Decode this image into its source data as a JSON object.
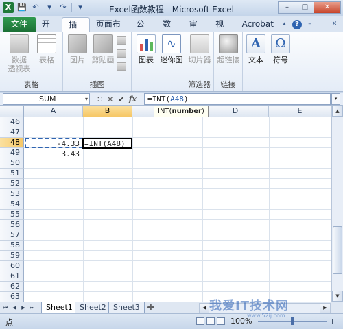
{
  "window": {
    "title": "Excel函数教程 - Microsoft Excel",
    "app_logo": "X"
  },
  "ribbon_tabs": {
    "file": "文件",
    "tabs": [
      "开始",
      "插入",
      "页面布局",
      "公式",
      "数据",
      "审阅",
      "视图",
      "Acrobat"
    ],
    "active": "插入"
  },
  "ribbon": {
    "groups": [
      {
        "label": "表格",
        "buttons": [
          {
            "label": "数据",
            "sub": "透视表"
          },
          {
            "label": "表格"
          }
        ]
      },
      {
        "label": "插图",
        "buttons": [
          {
            "label": "图片"
          },
          {
            "label": "剪贴画"
          }
        ]
      },
      {
        "label": "",
        "buttons": [
          {
            "label": "图表"
          },
          {
            "label": "迷你图"
          }
        ]
      },
      {
        "label": "筛选器",
        "buttons": [
          {
            "label": "切片器"
          }
        ]
      },
      {
        "label": "链接",
        "buttons": [
          {
            "label": "超链接"
          }
        ]
      },
      {
        "label": "",
        "buttons": [
          {
            "label": "文本"
          },
          {
            "label": "符号"
          }
        ]
      }
    ]
  },
  "formula_bar": {
    "name_box": "SUM",
    "formula_prefix": "=INT(",
    "formula_ref": "A48",
    "formula_suffix": ")",
    "tooltip_fn": "INT(",
    "tooltip_arg": "number",
    "tooltip_end": ")"
  },
  "sheet": {
    "columns": [
      "A",
      "B",
      "C",
      "D",
      "E"
    ],
    "selected_column": "B",
    "rows": [
      "46",
      "47",
      "48",
      "49",
      "50",
      "51",
      "52",
      "53",
      "54",
      "55",
      "56",
      "57",
      "58",
      "59",
      "60",
      "61",
      "62",
      "63"
    ],
    "selected_row": "48",
    "cells": {
      "A48": "-4.33",
      "A49": "3.43",
      "B48": "=INT(A48)"
    }
  },
  "sheet_tabs": [
    "Sheet1",
    "Sheet2",
    "Sheet3"
  ],
  "status": {
    "mode": "点",
    "zoom": "100%"
  },
  "watermark": {
    "main": "我爱IT技术网",
    "sub": "www.52ij.com"
  }
}
